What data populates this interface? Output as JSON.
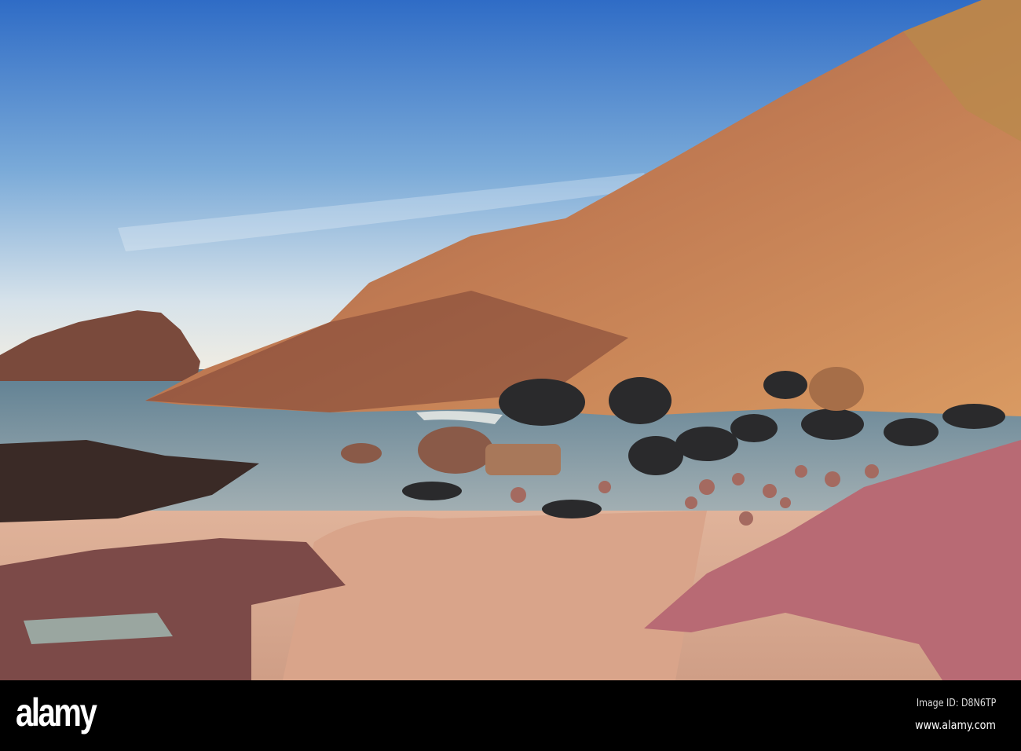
{
  "watermark": {
    "logo": "alamy",
    "image_id": "Image ID: D8N6TP",
    "url": "www.alamy.com"
  },
  "colors": {
    "sky_top": "#2f6cc6",
    "sky_horizon": "#eef0ec",
    "cliff": "#b8704c",
    "sea": "#6e8a98",
    "sand": "#d8a88e",
    "boulder": "#2a2a2c"
  }
}
